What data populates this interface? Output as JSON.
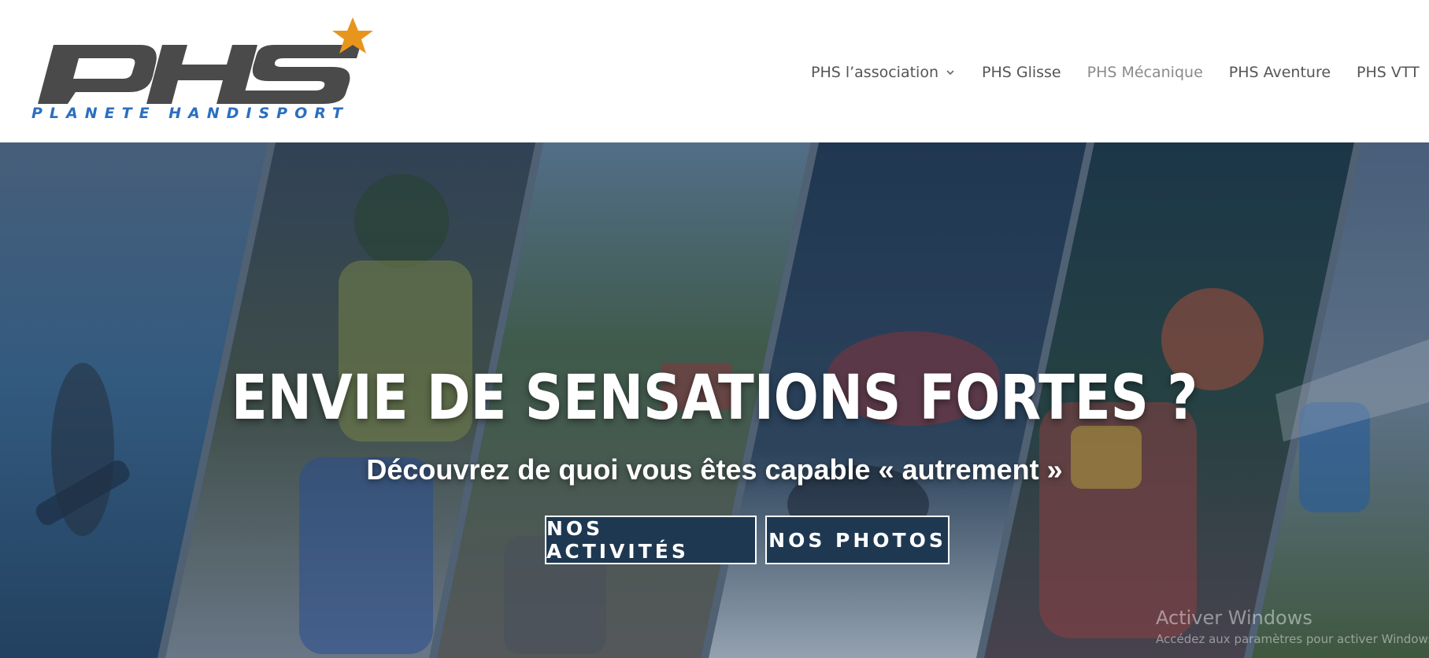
{
  "logo": {
    "mark": "PHS",
    "tagline": "PLANETE HANDISPORT",
    "star_color": "#e8951d",
    "mark_color": "#4a4a4a",
    "tagline_color": "#2a6fc0"
  },
  "nav": {
    "items": [
      {
        "label": "PHS l’association",
        "has_dropdown": true,
        "active": false
      },
      {
        "label": "PHS Glisse",
        "has_dropdown": false,
        "active": false
      },
      {
        "label": "PHS Mécanique",
        "has_dropdown": false,
        "active": true
      },
      {
        "label": "PHS Aventure",
        "has_dropdown": false,
        "active": false
      },
      {
        "label": "PHS VTT",
        "has_dropdown": false,
        "active": false
      }
    ]
  },
  "hero": {
    "title": "ENVIE DE SENSATIONS FORTES ?",
    "subtitle": "Découvrez de quoi vous êtes capable « autrement »",
    "buttons": {
      "activities": "NOS ACTIVITÉS",
      "photos": "NOS PHOTOS"
    },
    "button_color": "#1f3852",
    "overlay_color": "#1a2d46"
  },
  "watermark": {
    "title": "Activer Windows",
    "subtitle": "Accédez aux paramètres pour activer Windows."
  }
}
